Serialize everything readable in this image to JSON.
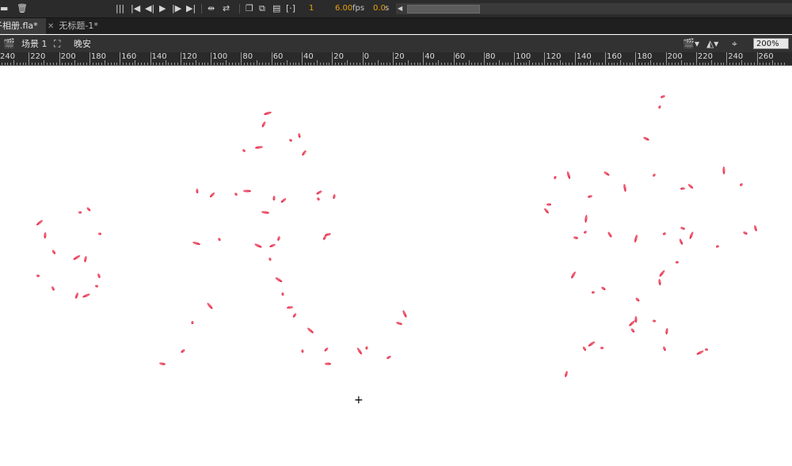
{
  "toolbar": {
    "frame": "1",
    "fps_value": "6.00",
    "fps_unit": "fps",
    "time_value": "0.0",
    "time_unit": "s"
  },
  "tabs": [
    {
      "label": "子相册.fla*",
      "active": true
    },
    {
      "label": "无标题-1*",
      "active": false
    }
  ],
  "editbar": {
    "scene": "场景 1",
    "symbol": "晚安",
    "zoom": "200%"
  },
  "ruler": {
    "labels": [
      "240",
      "220",
      "200",
      "180",
      "160",
      "140",
      "120",
      "100",
      "80",
      "60",
      "40",
      "20",
      "0",
      "20",
      "40",
      "60",
      "80",
      "100",
      "120",
      "140",
      "160",
      "180",
      "200",
      "220",
      "240",
      "260"
    ]
  },
  "colors": {
    "petal": "#e8203c",
    "petal_light": "#f47a8a",
    "panel_dark": "#2b2b2b",
    "accent_orange": "#e8a010"
  }
}
